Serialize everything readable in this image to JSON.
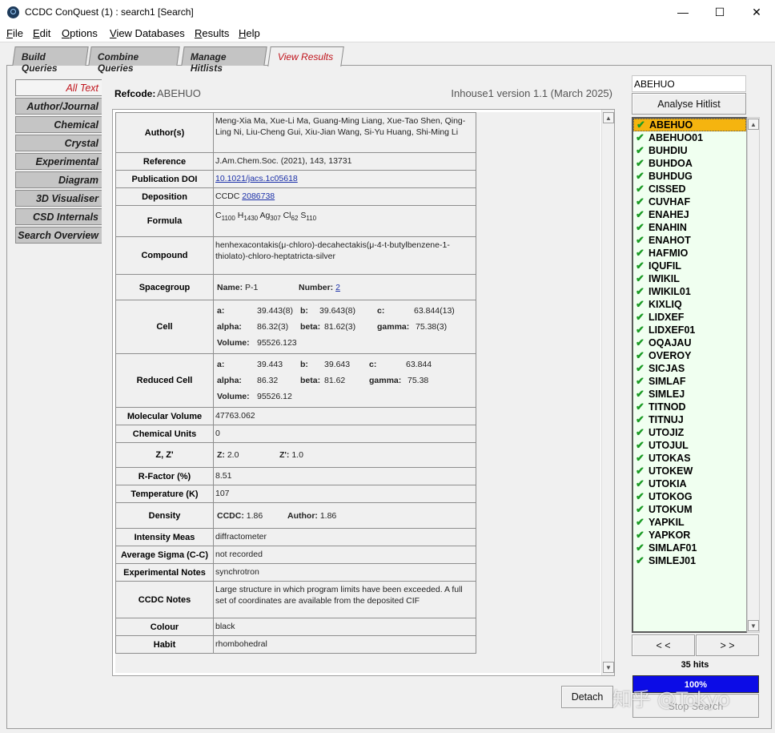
{
  "window": {
    "title": "CCDC ConQuest (1) : search1 [Search]",
    "minimize": "—",
    "maximize": "☐",
    "close": "✕"
  },
  "menu": {
    "items": [
      {
        "mn": "F",
        "rest": "ile"
      },
      {
        "mn": "E",
        "rest": "dit"
      },
      {
        "mn": "O",
        "rest": "ptions"
      },
      {
        "mn": "V",
        "rest": "iew Databases"
      },
      {
        "mn": "R",
        "rest": "esults"
      },
      {
        "mn": "H",
        "rest": "elp"
      }
    ]
  },
  "tabs": [
    "Build Queries",
    "Combine Queries",
    "Manage Hitlists",
    "View Results"
  ],
  "sidetabs": [
    "All Text",
    "Author/Journal",
    "Chemical",
    "Crystal",
    "Experimental",
    "Diagram",
    "3D Visualiser",
    "CSD Internals",
    "Search Overview"
  ],
  "header": {
    "refcode_label": "Refcode:",
    "refcode": "ABEHUO",
    "version": "Inhouse1 version 1.1 (March 2025)"
  },
  "details": {
    "authors_label": "Author(s)",
    "authors": "Meng-Xia Ma, Xue-Li Ma, Guang-Ming Liang, Xue-Tao Shen, Qing-Ling Ni, Liu-Cheng Gui, Xiu-Jian Wang, Si-Yu Huang, Shi-Ming Li",
    "reference_label": "Reference",
    "reference": "J.Am.Chem.Soc.  (2021), 143, 13731",
    "doi_label": "Publication DOI",
    "doi": "10.1021/jacs.1c05618",
    "deposition_label": "Deposition",
    "deposition_prefix": "CCDC",
    "deposition_number": "2086738",
    "formula_label": "Formula",
    "formula": [
      {
        "el": "C",
        "n": "1100"
      },
      {
        "el": "H",
        "n": "1430"
      },
      {
        "el": "Ag",
        "n": "307"
      },
      {
        "el": "Cl",
        "n": "62"
      },
      {
        "el": "S",
        "n": "110"
      }
    ],
    "compound_label": "Compound",
    "compound": "henhexacontakis(μ-chloro)-decahectakis(μ-4-t-butylbenzene-1-thiolato)-chloro-heptatricta-silver",
    "spacegroup_label": "Spacegroup",
    "sg_name_label": "Name:",
    "sg_name": "P-1",
    "sg_number_label": "Number:",
    "sg_number": "2",
    "cell_label": "Cell",
    "cell": {
      "a_l": "a:",
      "a": "39.443(8)",
      "b_l": "b:",
      "b": "39.643(8)",
      "c_l": "c:",
      "c": "63.844(13)",
      "alpha_l": "alpha:",
      "alpha": "86.32(3)",
      "beta_l": "beta:",
      "beta": "81.62(3)",
      "gamma_l": "gamma:",
      "gamma": "75.38(3)",
      "volume_l": "Volume:",
      "volume": "95526.123"
    },
    "reduced_label": "Reduced Cell",
    "reduced": {
      "a_l": "a:",
      "a": "39.443",
      "b_l": "b:",
      "b": "39.643",
      "c_l": "c:",
      "c": "63.844",
      "alpha_l": "alpha:",
      "alpha": "86.32",
      "beta_l": "beta:",
      "beta": "81.62",
      "gamma_l": "gamma:",
      "gamma": "75.38",
      "volume_l": "Volume:",
      "volume": "95526.12"
    },
    "molvol_label": "Molecular Volume",
    "molvol": "47763.062",
    "chemunits_label": "Chemical Units",
    "chemunits": "0",
    "zz_label": "Z, Z'",
    "z_l": "Z:",
    "z": "2.0",
    "zprime_l": "Z':",
    "zprime": "1.0",
    "rfactor_label": "R-Factor (%)",
    "rfactor": "8.51",
    "temp_label": "Temperature (K)",
    "temp": "107",
    "density_label": "Density",
    "density_ccdc_l": "CCDC:",
    "density_ccdc": "1.86",
    "density_author_l": "Author:",
    "density_author": "1.86",
    "intensity_label": "Intensity Meas",
    "intensity": "diffractometer",
    "sigma_label": "Average Sigma (C-C)",
    "sigma": "not recorded",
    "expnotes_label": "Experimental Notes",
    "expnotes": "synchrotron",
    "ccdcnotes_label": "CCDC Notes",
    "ccdcnotes": "Large structure in which program limits have been exceeded. A full set of coordinates are available from the deposited CIF",
    "colour_label": "Colour",
    "colour": "black",
    "habit_label": "Habit",
    "habit": "rhombohedral"
  },
  "right": {
    "search_value": "ABEHUO",
    "analyse_label": "Analyse Hitlist",
    "hits": [
      "ABEHUO",
      "ABEHUO01",
      "BUHDIU",
      "BUHDOA",
      "BUHDUG",
      "CISSED",
      "CUVHAF",
      "ENAHEJ",
      "ENAHIN",
      "ENAHOT",
      "HAFMIO",
      "IQUFIL",
      "IWIKIL",
      "IWIKIL01",
      "KIXLIQ",
      "LIDXEF",
      "LIDXEF01",
      "OQAJAU",
      "OVEROY",
      "SICJAS",
      "SIMLAF",
      "SIMLEJ",
      "TITNOD",
      "TITNUJ",
      "UTOJIZ",
      "UTOJUL",
      "UTOKAS",
      "UTOKEW",
      "UTOKIA",
      "UTOKOG",
      "UTOKUM",
      "YAPKIL",
      "YAPKOR",
      "SIMLAF01",
      "SIMLEJ01"
    ],
    "selected_index": 0,
    "prev_label": "< <",
    "next_label": "> >",
    "hits_count": "35 hits",
    "progress": "100%",
    "stop_label": "Stop Search",
    "detach_label": "Detach"
  },
  "watermark": "知乎 @Tokyo",
  "colors": {
    "accent_red": "#c0141c",
    "selection": "#f5b40f",
    "progress": "#0c0ce6",
    "hitlist_bg": "#f0fff0"
  }
}
